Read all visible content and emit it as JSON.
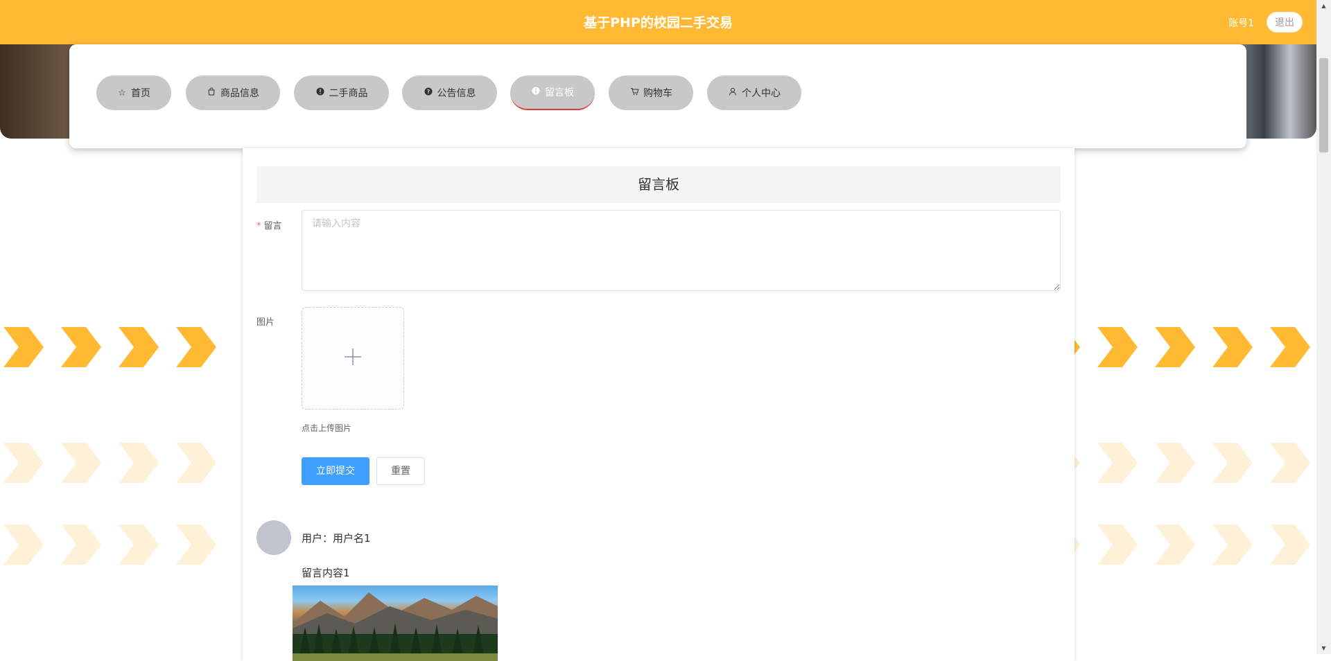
{
  "header": {
    "title": "基于PHP的校园二手交易",
    "account": "账号1",
    "logout_label": "退出",
    "color": "#ffb933"
  },
  "nav": {
    "items": [
      {
        "label": "首页",
        "icon": "star-icon"
      },
      {
        "label": "商品信息",
        "icon": "bag-icon"
      },
      {
        "label": "二手商品",
        "icon": "warning-icon"
      },
      {
        "label": "公告信息",
        "icon": "question-icon"
      },
      {
        "label": "留言板",
        "icon": "info-icon",
        "active": true
      },
      {
        "label": "购物车",
        "icon": "cart-icon"
      },
      {
        "label": "个人中心",
        "icon": "user-icon"
      }
    ]
  },
  "form": {
    "title": "留言板",
    "message_label": "留言",
    "message_placeholder": "请输入内容",
    "image_label": "图片",
    "upload_tip": "点击上传图片",
    "submit_label": "立即提交",
    "reset_label": "重置"
  },
  "messages": [
    {
      "user": "用户：用户名1",
      "content": "留言内容1"
    }
  ],
  "colors": {
    "accent": "#409eff",
    "required": "#f56c6c",
    "active_underline": "#e53935"
  }
}
